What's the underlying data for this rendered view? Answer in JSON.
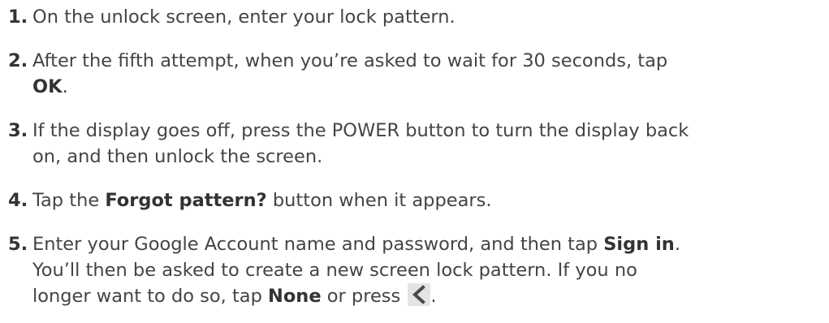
{
  "steps": [
    {
      "number": "1.",
      "text": "On the unlock screen, enter your lock pattern."
    },
    {
      "number": "2.",
      "text_before": "After the fifth attempt, when you’re asked to wait for 30 seconds, tap",
      "ok": "OK",
      "text_after": "."
    },
    {
      "number": "3.",
      "line1": "If the display goes off, press the POWER button to turn the display back",
      "line2": "on, and then unlock the screen."
    },
    {
      "number": "4.",
      "text_before": "Tap the",
      "bold": "Forgot pattern?",
      "text_after": "button when it appears."
    },
    {
      "number": "5.",
      "line1_before": "Enter your Google Account name and password, and then tap",
      "sign_in": "Sign in",
      "line1_after": ".",
      "line2": "You’ll then be asked to create a new screen lock pattern. If you no",
      "line3_before": "longer want to do so, tap",
      "none": "None",
      "line3_mid": "or press",
      "line3_after": "."
    }
  ],
  "icons": {
    "back": "back-arrow-icon"
  }
}
